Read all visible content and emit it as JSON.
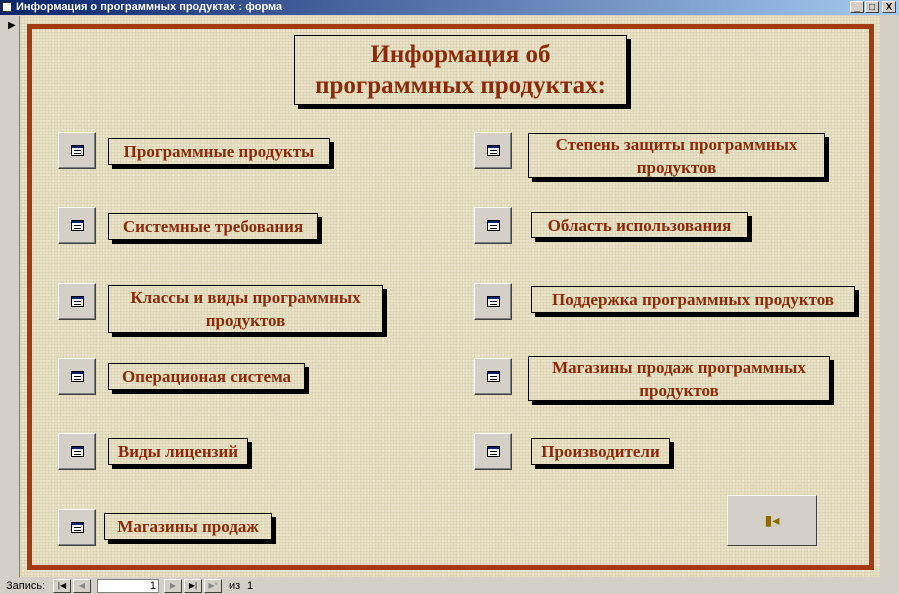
{
  "window": {
    "title": "Информация о программных продуктах : форма",
    "minimize": "_",
    "maximize": "□",
    "close": "X"
  },
  "form": {
    "title": "Информация об программных продуктах:",
    "left_items": [
      "Программные продукты",
      "Системные требования",
      "Классы и виды программных продуктов",
      "Операционая система",
      "Виды лицензий",
      "Магазины продаж"
    ],
    "right_items": [
      "Степень защиты программных продуктов",
      "Область использования",
      "Поддержка программных продуктов",
      "Магазины продаж программных продуктов",
      "Производители"
    ],
    "exit_icon": "door-exit-icon"
  },
  "navigator": {
    "label": "Запись:",
    "current": "1",
    "of_label": "из",
    "total": "1"
  }
}
